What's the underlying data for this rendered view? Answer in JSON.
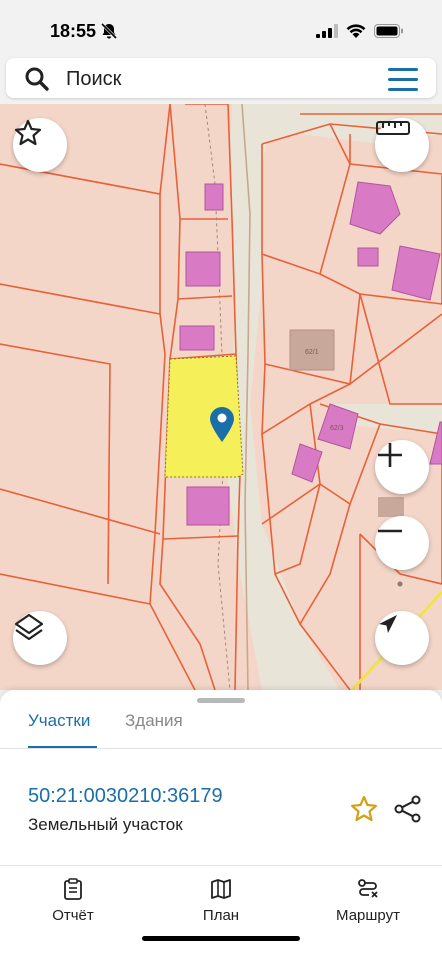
{
  "status": {
    "time": "18:55"
  },
  "search": {
    "placeholder": "Поиск"
  },
  "map": {
    "labels": [
      "62/1",
      "62/3"
    ]
  },
  "sheet": {
    "tabs": [
      {
        "label": "Участки",
        "active": true
      },
      {
        "label": "Здания",
        "active": false
      }
    ],
    "parcel": {
      "cadastral_number": "50:21:0030210:36179",
      "type": "Земельный участок"
    }
  },
  "bottom_nav": [
    {
      "label": "Отчёт",
      "icon": "report-icon"
    },
    {
      "label": "План",
      "icon": "map-book-icon"
    },
    {
      "label": "Маршрут",
      "icon": "route-icon"
    }
  ],
  "colors": {
    "accent": "#1a6fa8",
    "parcel_fill": "#f5ef5a",
    "building": "#d97bc4",
    "plot_line": "#e8613a",
    "star_gold": "#d4a017"
  }
}
